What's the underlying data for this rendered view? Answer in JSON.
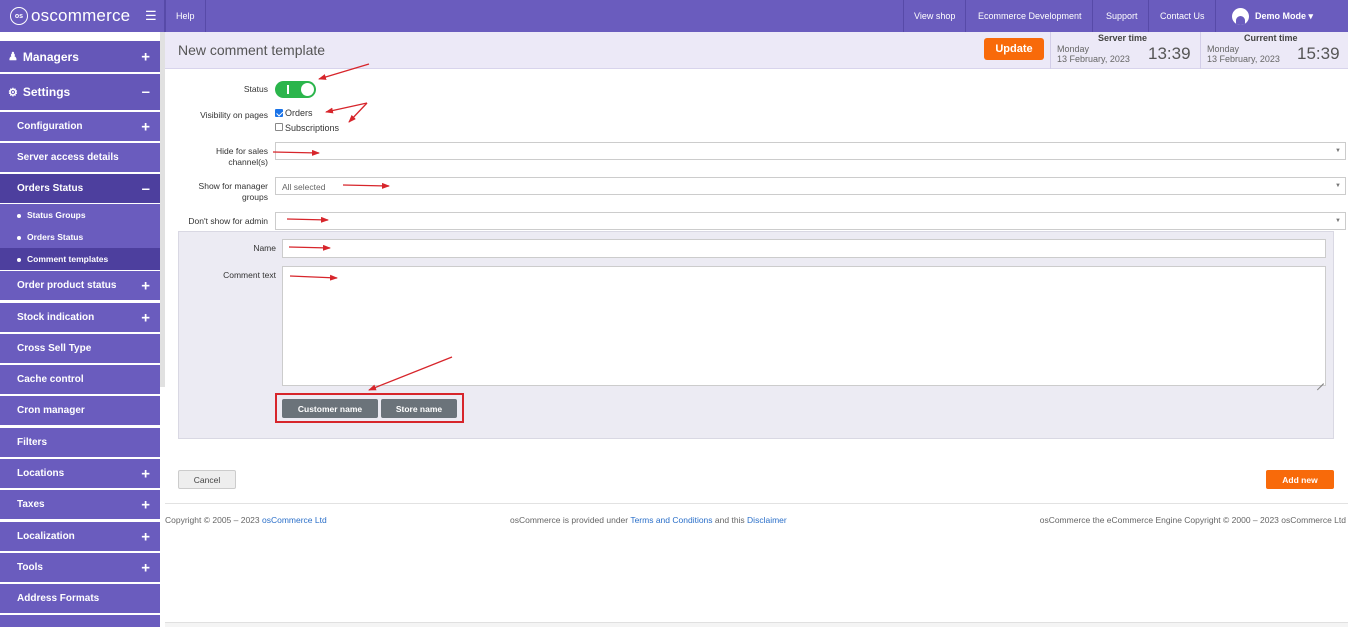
{
  "topbar": {
    "logo_text": "oscommerce",
    "logo_icon": "oscommerce-logo-icon",
    "menu_icon": "hamburger-icon",
    "help": "Help",
    "view_shop": "View shop",
    "ecommerce_development": "Ecommerce Development",
    "support": "Support",
    "contact_us": "Contact Us",
    "user_icon": "user-icon",
    "demo_mode": "Demo Mode ▾"
  },
  "sidebar": {
    "managers": "Managers",
    "settings": "Settings",
    "items": [
      {
        "label": "Configuration",
        "icon": "plus"
      },
      {
        "label": "Server access details",
        "icon": ""
      },
      {
        "label": "Orders Status",
        "icon": "minus"
      },
      {
        "label": "Order product status",
        "icon": "plus"
      },
      {
        "label": "Stock indication",
        "icon": "plus"
      },
      {
        "label": "Cross Sell Type",
        "icon": ""
      },
      {
        "label": "Cache control",
        "icon": ""
      },
      {
        "label": "Cron manager",
        "icon": ""
      },
      {
        "label": "Filters",
        "icon": ""
      },
      {
        "label": "Locations",
        "icon": "plus"
      },
      {
        "label": "Taxes",
        "icon": "plus"
      },
      {
        "label": "Localization",
        "icon": "plus"
      },
      {
        "label": "Tools",
        "icon": "plus"
      },
      {
        "label": "Address Formats",
        "icon": ""
      }
    ],
    "sub_items": [
      {
        "label": "Status Groups"
      },
      {
        "label": "Orders Status"
      },
      {
        "label": "Comment templates"
      }
    ]
  },
  "header": {
    "title": "New comment template",
    "update": "Update",
    "server_time": {
      "label": "Server time",
      "day": "Monday",
      "date": "13 February, 2023",
      "time": "13:39"
    },
    "current_time": {
      "label": "Current time",
      "day": "Monday",
      "date": "13 February, 2023",
      "time": "15:39"
    }
  },
  "form": {
    "status_label": "Status",
    "status_on": true,
    "visibility_label": "Visibility on pages",
    "orders_label": "Orders",
    "orders_checked": true,
    "subscriptions_label": "Subscriptions",
    "subscriptions_checked": false,
    "hide_sales_label": "Hide for sales channel(s)",
    "hide_sales_value": "",
    "show_manager_label": "Show for manager groups",
    "show_manager_value": "All selected",
    "dont_show_admin_label": "Don't show for admin",
    "dont_show_admin_value": "",
    "name_label": "Name",
    "name_value": "",
    "comment_label": "Comment text",
    "comment_value": "",
    "customer_name_button": "Customer name",
    "store_name_button": "Store name",
    "cancel": "Cancel",
    "add_new": "Add new"
  },
  "footer": {
    "copyright_prefix": "Copyright © 2005 – 2023 ",
    "copyright_link": "osCommerce Ltd",
    "provided_prefix": "osCommerce is provided under ",
    "terms_link": "Terms and Conditions",
    "and_this": " and this ",
    "disclaimer_link": "Disclaimer",
    "engine_text": "osCommerce the eCommerce Engine Copyright © 2000 – 2023 osCommerce Ltd"
  },
  "colors": {
    "brand": "#6a5cbe",
    "sidebar_active": "#4d3f9e",
    "accent_orange": "#f86a0a",
    "toggle_green": "#2bb54c",
    "annotation_red": "#d7252b"
  }
}
